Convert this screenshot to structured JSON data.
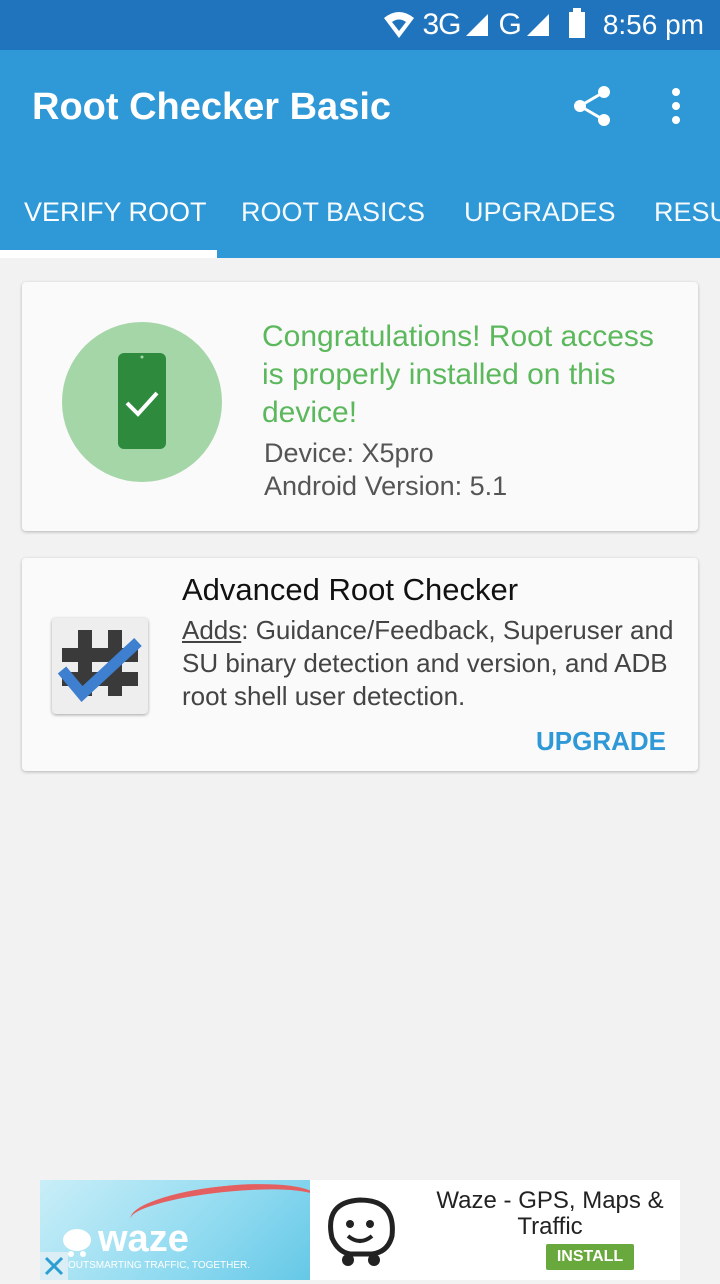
{
  "status_bar": {
    "network_label_1": "3G",
    "network_label_2": "G",
    "time": "8:56 pm"
  },
  "app_bar": {
    "title": "Root Checker Basic",
    "share_icon": "share-icon",
    "more_icon": "more-vertical-icon"
  },
  "tabs": [
    {
      "label": "VERIFY ROOT",
      "selected": true
    },
    {
      "label": "ROOT BASICS",
      "selected": false
    },
    {
      "label": "UPGRADES",
      "selected": false
    },
    {
      "label": "RESU",
      "selected": false
    }
  ],
  "root_card": {
    "message": "Congratulations! Root access is properly installed on this device!",
    "device": "Device: X5pro",
    "android_version": "Android Version: 5.1",
    "status_color": "#5cb85c"
  },
  "advanced_card": {
    "title": "Advanced Root Checker",
    "adds_label": "Adds",
    "description": ": Guidance/Feedback, Superuser and SU binary detection and version, and ADB root shell user detection.",
    "upgrade_label": "UPGRADE"
  },
  "ad": {
    "brand": "waze",
    "tagline": "OUTSMARTING TRAFFIC, TOGETHER.",
    "title": "Waze - GPS, Maps & Traffic",
    "install_label": "INSTALL"
  },
  "colors": {
    "status_bar": "#1f74bd",
    "app_bar": "#2f98d6",
    "accent": "#2f98d6",
    "success": "#5cb85c"
  }
}
